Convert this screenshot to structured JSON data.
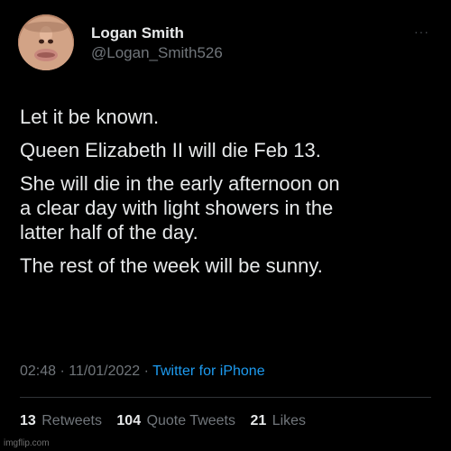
{
  "user": {
    "display_name": "Logan Smith",
    "handle": "@Logan_Smith526"
  },
  "more_menu": {
    "label": "···"
  },
  "tweet": {
    "paragraphs": [
      "Let it be known.",
      "Queen Elizabeth II will die Feb 13.",
      "She will die in the early afternoon on\na clear day with light showers in the\nlatter half of the day.",
      "The rest of the week will be sunny."
    ]
  },
  "meta": {
    "time": "02:48",
    "separator1": " · ",
    "date": "11/01/2022",
    "separator2": " · ",
    "source": "Twitter for iPhone"
  },
  "stats": {
    "retweets_count": "13",
    "retweets_label": "Retweets",
    "quotes_count": "104",
    "quotes_label": "Quote Tweets",
    "likes_count": "21",
    "likes_label": "Likes"
  },
  "watermark": {
    "text": "imgflip.com"
  },
  "colors": {
    "background": "#000000",
    "primary_text": "#e7e9ea",
    "secondary_text": "#71767b",
    "link": "#1d9bf0"
  },
  "icons": {
    "avatar": "user-avatar-photo",
    "more": "more-options-icon"
  }
}
